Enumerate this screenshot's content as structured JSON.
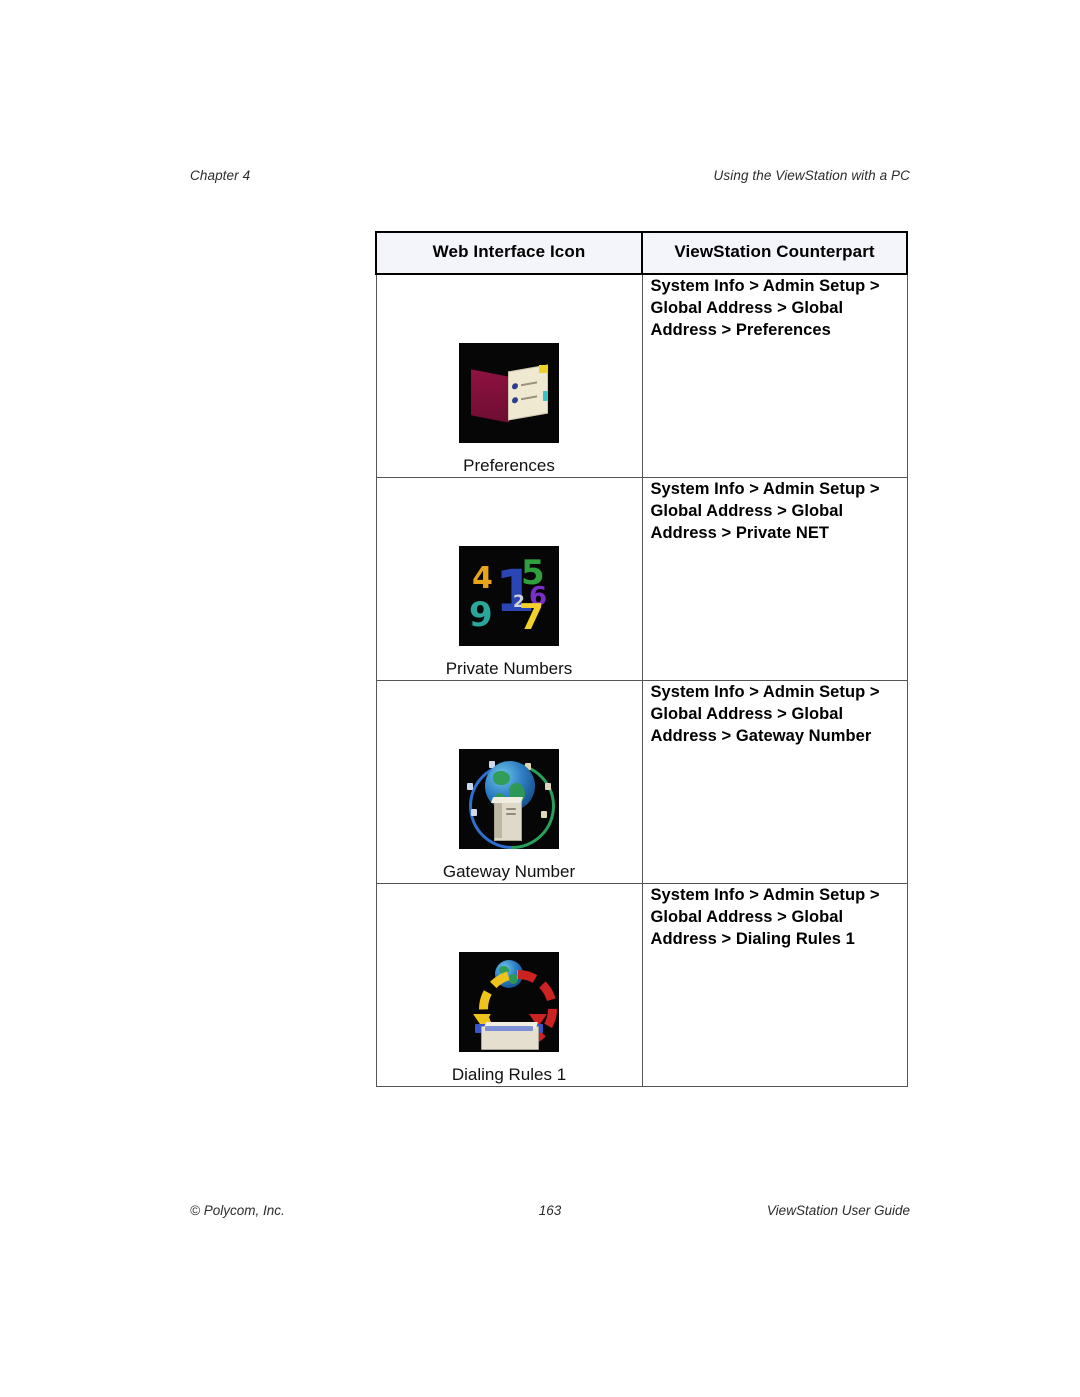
{
  "header": {
    "left": "Chapter 4",
    "right": "Using the ViewStation with a PC"
  },
  "table": {
    "columns": [
      "Web Interface Icon",
      "ViewStation Counterpart"
    ],
    "rows": [
      {
        "icon_name": "preferences-book-icon",
        "caption": "Preferences",
        "path": "System Info > Admin Setup > Global Address > Global Address > Preferences"
      },
      {
        "icon_name": "private-numbers-icon",
        "caption": "Private Numbers",
        "path": "System Info > Admin Setup > Global Address > Global Address > Private NET"
      },
      {
        "icon_name": "gateway-number-globe-icon",
        "caption": "Gateway Number",
        "path": "System Info > Admin Setup > Global Address > Global Address > Gateway Number"
      },
      {
        "icon_name": "dialing-rules-icon",
        "caption": "Dialing Rules 1",
        "path": "System Info > Admin Setup > Global Address > Global Address > Dialing Rules 1"
      }
    ]
  },
  "footer": {
    "left": "© Polycom, Inc.",
    "center": "163",
    "right": "ViewStation User Guide"
  },
  "colors": {
    "header_fill": "#f4f4fb",
    "border_strong": "#000000",
    "border_light": "#555555",
    "icon_background": "#060606",
    "book_cover": "#8f1240",
    "book_page": "#efe9d2"
  }
}
